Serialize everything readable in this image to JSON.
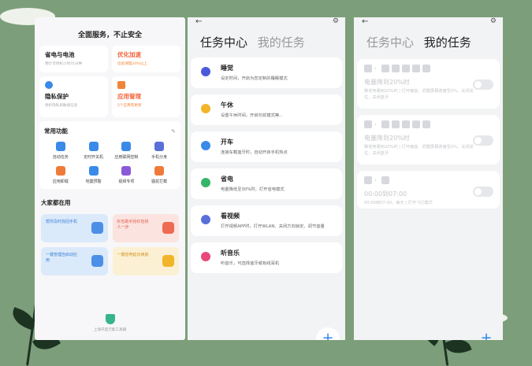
{
  "left_panel": {
    "title": "全面服务，不止安全",
    "cards": [
      {
        "title": "省电与电池",
        "sub": "预计可待机小时31分钟",
        "style": "normal"
      },
      {
        "title": "优化加速",
        "sub": "垃圾清理24%以上",
        "style": "orange"
      },
      {
        "title": "隐私保护",
        "sub": "保护隐私和敏感信息",
        "style": "normal"
      },
      {
        "title": "应用管理",
        "sub": "5个应用有更新",
        "style": "orange"
      }
    ],
    "functions": {
      "heading": "常用功能",
      "edit_icon": "edit-icon",
      "items": [
        {
          "label": "自动任务",
          "color": "#3a8ae8"
        },
        {
          "label": "定时开关机",
          "color": "#3a8ae8"
        },
        {
          "label": "应用联网控制",
          "color": "#3a8ae8"
        },
        {
          "label": "手机分身",
          "color": "#5a6fd8"
        },
        {
          "label": "应用卸载",
          "color": "#f07a3a"
        },
        {
          "label": "地震预警",
          "color": "#3a8ae8"
        },
        {
          "label": "视频专项",
          "color": "#8a5ad8"
        },
        {
          "label": "骚扰拦截",
          "color": "#f07a3a"
        }
      ]
    },
    "common": {
      "heading": "大家都在用",
      "cards": [
        {
          "text": "帮你及时找回手机",
          "style": "blue"
        },
        {
          "text": "红包助手抢红包快人一步",
          "style": "red"
        },
        {
          "text": "一键管理自启动应用",
          "style": "blue"
        },
        {
          "text": "一键省电延长续航",
          "style": "yellow"
        }
      ]
    },
    "footer": "上滑开启万能工具箱"
  },
  "task_center": {
    "tab_active": "任务中心",
    "tab_inactive": "我的任务",
    "tasks": [
      {
        "title": "睡觉",
        "desc": "设定时间，开启为您定制的睡眠模式",
        "color": "#4a5bd8"
      },
      {
        "title": "午休",
        "desc": "设置午休时间，开启勿扰模式等...",
        "color": "#f2b52a"
      },
      {
        "title": "开车",
        "desc": "连接车载蓝牙时，自动开启手机热点",
        "color": "#3a8ae8"
      },
      {
        "title": "省电",
        "desc": "电量降低至30%时，打开省电模式",
        "color": "#36b56a"
      },
      {
        "title": "看视频",
        "desc": "打开视频APP时，打开WLAN、关闭方向锁定、调节音量",
        "color": "#5a6fd8"
      },
      {
        "title": "听音乐",
        "desc": "听音乐，可选择蓝牙或有线耳机",
        "color": "#e8487a"
      }
    ],
    "add_label": "+"
  },
  "my_tasks": {
    "tab_inactive": "任务中心",
    "tab_active": "我的任务",
    "tasks": [
      {
        "title": "电量降到20%时",
        "desc": "降低电量到20%时 | 打开静音、调整屏幕亮度至0%、关闭定位、关闭蓝牙",
        "chips": 5
      },
      {
        "title": "电量降到20%时",
        "desc": "降低电量到20%时 | 打开静音、调整屏幕亮度至0%、关闭定位、关闭蓝牙",
        "chips": 5
      },
      {
        "title": "00:00到07:00",
        "desc": "00:00到07:00，每天 | 打开飞行模式",
        "chips": 1
      }
    ],
    "add_label": "+"
  }
}
